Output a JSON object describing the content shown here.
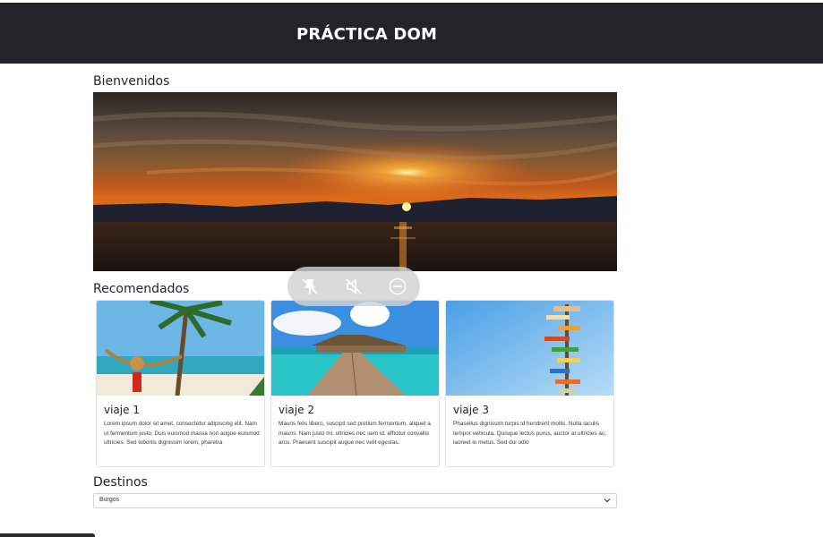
{
  "header": {
    "title": "PRÁCTICA DOM"
  },
  "sections": {
    "welcome_heading": "Bienvenidos",
    "recommended_heading": "Recomendados",
    "destinations_heading": "Destinos"
  },
  "hero": {
    "image": "sunset-over-sea"
  },
  "cards": [
    {
      "title": "viaje 1",
      "image": "beach-hammock-palm",
      "text": "Lorem ipsum dolor sit amet, consectetur adipiscing elit. Nam ut fermentum justo. Duis euismod massa non augue euismod ultricies. Sed lobortis dignissim lorem, pharetra"
    },
    {
      "title": "viaje 2",
      "image": "overwater-bungalows-pier",
      "text": "Mauris felis libero, suscipit sed pretium fermentum, aliquet a mauris. Nam justo mi, ultricies nec sem id, efficitur convallis arcu. Praesent suscipit augue nec velit egestas."
    },
    {
      "title": "viaje 3",
      "image": "signpost-blue-sky",
      "text": "Phasellus dignissim turpis id hendrerit mollis. Nulla iaculis tempor vehicula. Quisque lectus purus, auctor at ultricies ac, laoreet in metus. Sed dui odio"
    }
  ],
  "destinations": {
    "selected": "Burgos"
  },
  "overlay_controls": [
    "pin-off-icon",
    "mute-icon",
    "minus-circle-icon"
  ],
  "colors": {
    "header_bg": "#212529",
    "header_text": "#ffffff",
    "overlay_bg": "#d2d2d2"
  }
}
